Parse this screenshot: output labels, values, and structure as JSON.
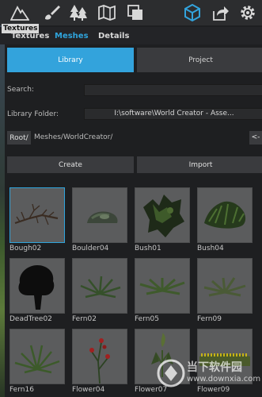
{
  "toolbar": {
    "icons": [
      "mountain-icon",
      "brush-icon",
      "trees-icon",
      "map-icon",
      "layers-icon",
      "cube-icon",
      "share-icon",
      "gear-icon"
    ],
    "tooltip": "Textures"
  },
  "tabs": [
    {
      "label": "Textures",
      "active": false
    },
    {
      "label": "Meshes",
      "active": true
    },
    {
      "label": "Details",
      "active": false
    }
  ],
  "segmented": {
    "library": "Library",
    "project": "Project",
    "selected": "Library"
  },
  "search": {
    "label": "Search:",
    "value": ""
  },
  "library_folder": {
    "label": "Library Folder:",
    "value": "I:\\software\\World Creator - Asse..."
  },
  "path": {
    "root_label": "Root/",
    "current": "Meshes/WorldCreator/",
    "back_label": "<-"
  },
  "actions": {
    "create": "Create",
    "import": "Import"
  },
  "meshes": [
    {
      "name": "Bough02",
      "selected": true
    },
    {
      "name": "Boulder04",
      "selected": false
    },
    {
      "name": "Bush01",
      "selected": false
    },
    {
      "name": "Bush04",
      "selected": false
    },
    {
      "name": "DeadTree02",
      "selected": false
    },
    {
      "name": "Fern02",
      "selected": false
    },
    {
      "name": "Fern05",
      "selected": false
    },
    {
      "name": "Fern09",
      "selected": false
    },
    {
      "name": "Fern16",
      "selected": false
    },
    {
      "name": "Flower04",
      "selected": false
    },
    {
      "name": "Flower07",
      "selected": false
    },
    {
      "name": "Flower09",
      "selected": false
    }
  ],
  "watermark": {
    "line1": "当下软件园",
    "line2": "www.downxia.com"
  },
  "colors": {
    "accent": "#33a3dc",
    "panel": "#1e1f21",
    "button": "#3a3b3e",
    "thumb_bg": "#5b5c5d"
  }
}
